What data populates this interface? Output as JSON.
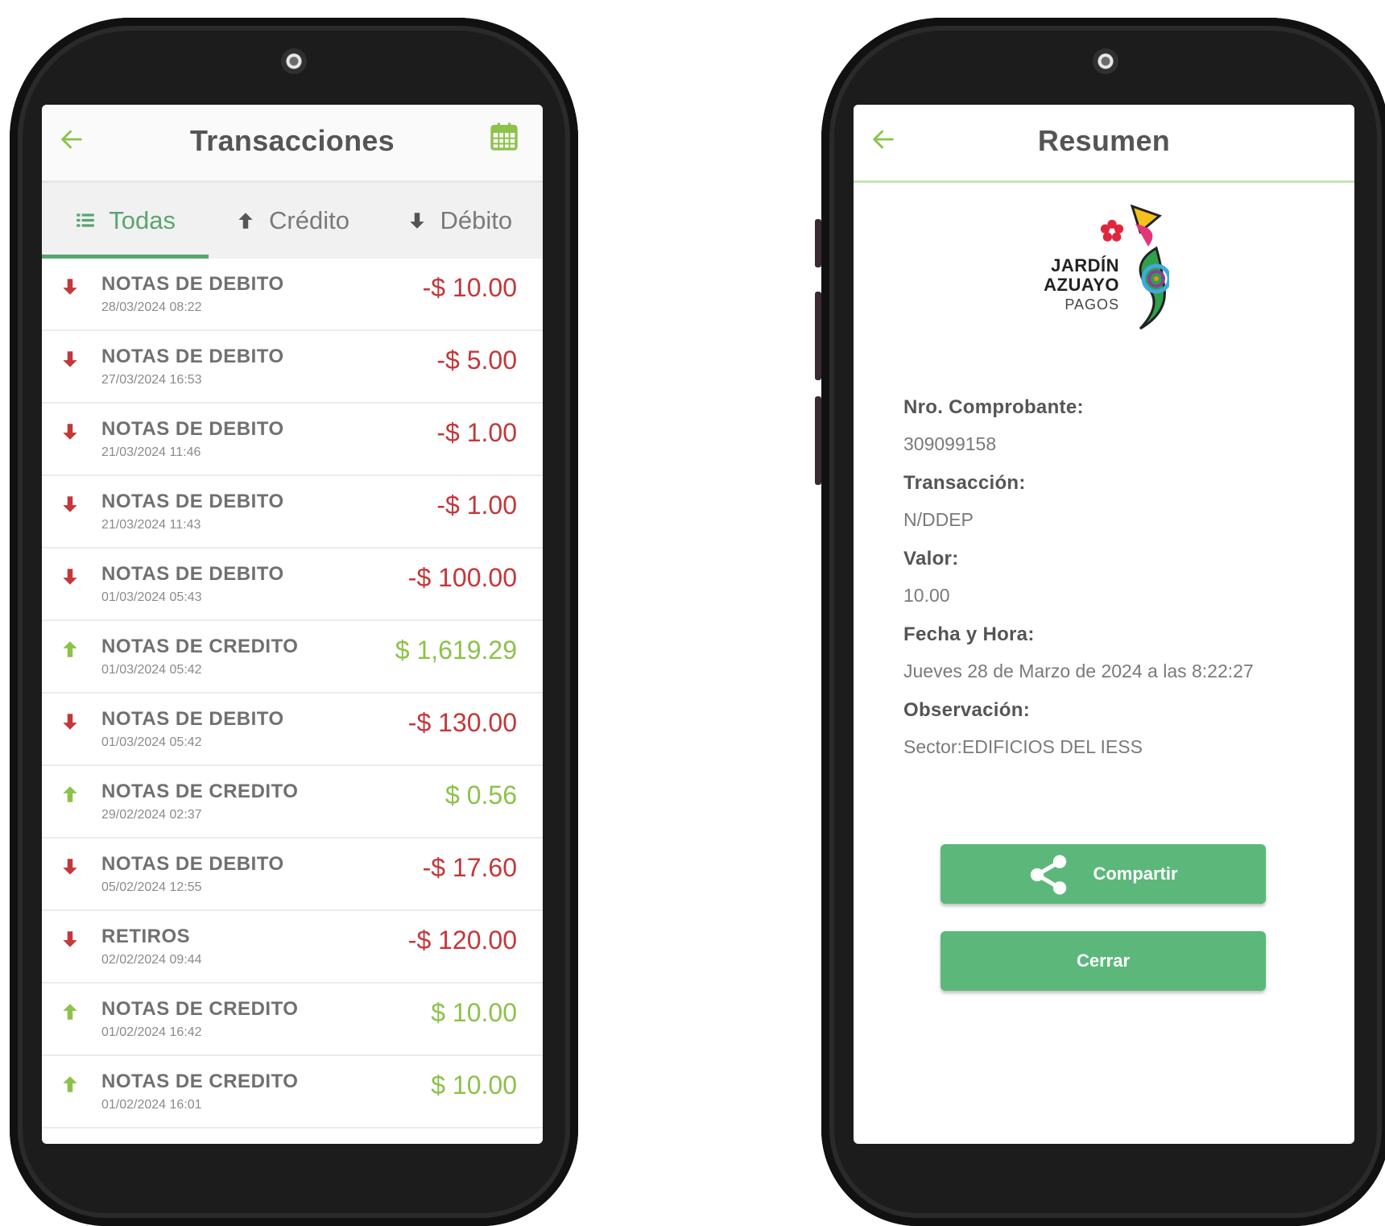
{
  "colors": {
    "accent": "#5aa572",
    "button": "#5cb87a",
    "debit": "#c4373a",
    "credit": "#8cc24a"
  },
  "transactions_screen": {
    "title": "Transacciones",
    "back_icon": "back-arrow-icon",
    "calendar_icon": "calendar-icon",
    "tabs": [
      {
        "label": "Todas",
        "icon": "list-icon",
        "active": true
      },
      {
        "label": "Crédito",
        "icon": "arrow-up-icon",
        "active": false
      },
      {
        "label": "Débito",
        "icon": "arrow-down-icon",
        "active": false
      }
    ],
    "items": [
      {
        "name": "NOTAS DE DEBITO",
        "date": "28/03/2024 08:22",
        "amount": "-$ 10.00",
        "type": "debit"
      },
      {
        "name": "NOTAS DE DEBITO",
        "date": "27/03/2024 16:53",
        "amount": "-$ 5.00",
        "type": "debit"
      },
      {
        "name": "NOTAS DE DEBITO",
        "date": "21/03/2024 11:46",
        "amount": "-$ 1.00",
        "type": "debit"
      },
      {
        "name": "NOTAS DE DEBITO",
        "date": "21/03/2024 11:43",
        "amount": "-$ 1.00",
        "type": "debit"
      },
      {
        "name": "NOTAS DE DEBITO",
        "date": "01/03/2024 05:43",
        "amount": "-$ 100.00",
        "type": "debit"
      },
      {
        "name": "NOTAS DE CREDITO",
        "date": "01/03/2024 05:42",
        "amount": "$ 1,619.29",
        "type": "credit"
      },
      {
        "name": "NOTAS DE DEBITO",
        "date": "01/03/2024 05:42",
        "amount": "-$ 130.00",
        "type": "debit"
      },
      {
        "name": "NOTAS DE CREDITO",
        "date": "29/02/2024 02:37",
        "amount": "$ 0.56",
        "type": "credit"
      },
      {
        "name": "NOTAS DE DEBITO",
        "date": "05/02/2024 12:55",
        "amount": "-$ 17.60",
        "type": "debit"
      },
      {
        "name": "RETIROS",
        "date": "02/02/2024 09:44",
        "amount": "-$ 120.00",
        "type": "debit"
      },
      {
        "name": "NOTAS DE CREDITO",
        "date": "01/02/2024 16:42",
        "amount": "$ 10.00",
        "type": "credit"
      },
      {
        "name": "NOTAS DE CREDITO",
        "date": "01/02/2024 16:01",
        "amount": "$ 10.00",
        "type": "credit"
      }
    ]
  },
  "summary_screen": {
    "title": "Resumen",
    "logo": {
      "line1": "JARDÍN",
      "line2": "AZUAYO",
      "sub": "PAGOS"
    },
    "fields": [
      {
        "label": "Nro. Comprobante:",
        "value": "309099158"
      },
      {
        "label": "Transacción:",
        "value": "N/DDEP"
      },
      {
        "label": "Valor:",
        "value": "10.00"
      },
      {
        "label": "Fecha y Hora:",
        "value": "Jueves 28 de Marzo de 2024 a las 8:22:27"
      },
      {
        "label": "Observación:",
        "value": "Sector:EDIFICIOS DEL IESS"
      }
    ],
    "share_label": "Compartir",
    "close_label": "Cerrar"
  }
}
